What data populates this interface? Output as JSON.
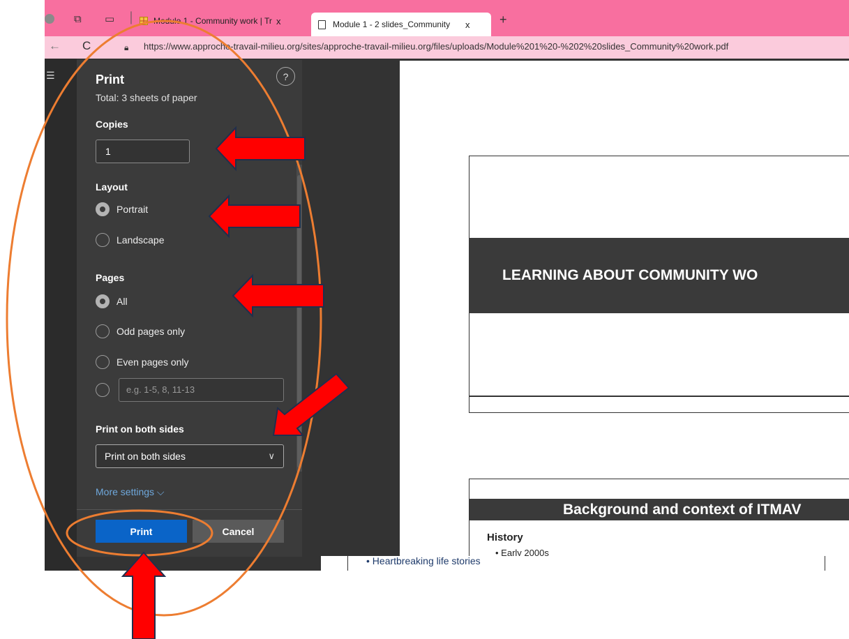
{
  "browser": {
    "tabs": [
      {
        "title": "Module 1 - Community work | Tr",
        "close": "x"
      },
      {
        "title": "Module 1 - 2 slides_Community",
        "close": "x"
      }
    ],
    "new_tab_label": "+",
    "back_label": "←",
    "reload_label": "C",
    "url": "https://www.approche-travail-milieu.org/sites/approche-travail-milieu.org/files/uploads/Module%201%20-%202%20slides_Community%20work.pdf"
  },
  "print_dialog": {
    "title": "Print",
    "total": "Total: 3 sheets of paper",
    "help_label": "?",
    "copies": {
      "label": "Copies",
      "value": "1"
    },
    "layout": {
      "label": "Layout",
      "options": [
        "Portrait",
        "Landscape"
      ],
      "selected": "Portrait"
    },
    "pages": {
      "label": "Pages",
      "options": [
        "All",
        "Odd pages only",
        "Even pages only"
      ],
      "selected": "All",
      "range_placeholder": "e.g. 1-5, 8, 11-13"
    },
    "duplex": {
      "label": "Print on both sides",
      "value": "Print on both sides"
    },
    "more_settings": "More settings ⌵",
    "print_button": "Print",
    "cancel_button": "Cancel"
  },
  "document": {
    "slide1_title": "LEARNING ABOUT COMMUNITY WO",
    "slide2_title": "Background and context of ITMAV",
    "slide2_heading": "History",
    "slide2_bullet": "•   Early 2000s",
    "lower_bullet": "•   Heartbreaking life stories"
  },
  "colors": {
    "tab_bar": "#f86f9f",
    "panel_bg": "#3b3b3b",
    "print_button": "#0a64c8",
    "annotation_arrow": "#ff0000",
    "annotation_ellipse": "#ed7d31"
  }
}
